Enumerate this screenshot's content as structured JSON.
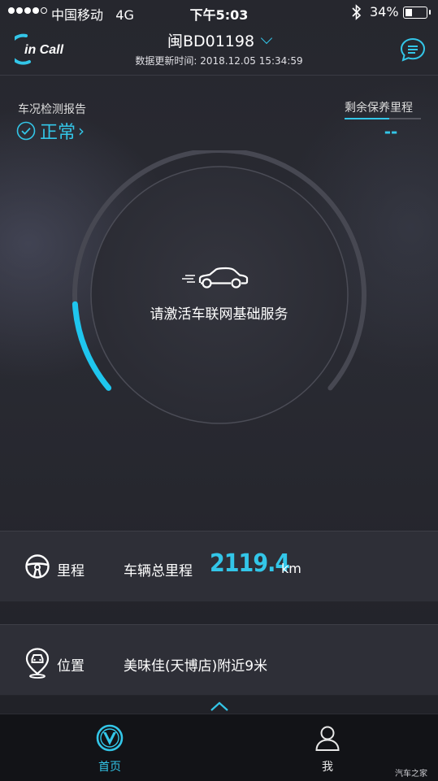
{
  "status_bar": {
    "carrier": "中国移动",
    "network": "4G",
    "time": "下午5:03",
    "battery_percent": "34%",
    "battery_level": 0.34
  },
  "header": {
    "logo_text": "in Call",
    "vehicle_plate": "闽BD01198",
    "update_time": "数据更新时间: 2018.12.05 15:34:59"
  },
  "report": {
    "label": "车况检测报告",
    "status": "正常",
    "arrow": "›"
  },
  "maintenance": {
    "label": "剩余保养里程",
    "value": "--",
    "progress": 0.58
  },
  "gauge": {
    "message": "请激活车联网基础服务",
    "fill_fraction": 0.14
  },
  "mileage": {
    "label": "里程",
    "description": "车辆总里程",
    "value": "2119.4",
    "unit": "km"
  },
  "location": {
    "label": "位置",
    "description": "美味佳(天博店)附近9米"
  },
  "tabs": [
    {
      "label": "首页",
      "icon": "changan-logo-icon",
      "active": true
    },
    {
      "label": "我",
      "icon": "person-icon",
      "active": false
    }
  ],
  "watermark": "汽车之家",
  "colors": {
    "accent": "#33c6e8",
    "card": "#2e2f37",
    "tabbar": "#121317"
  }
}
